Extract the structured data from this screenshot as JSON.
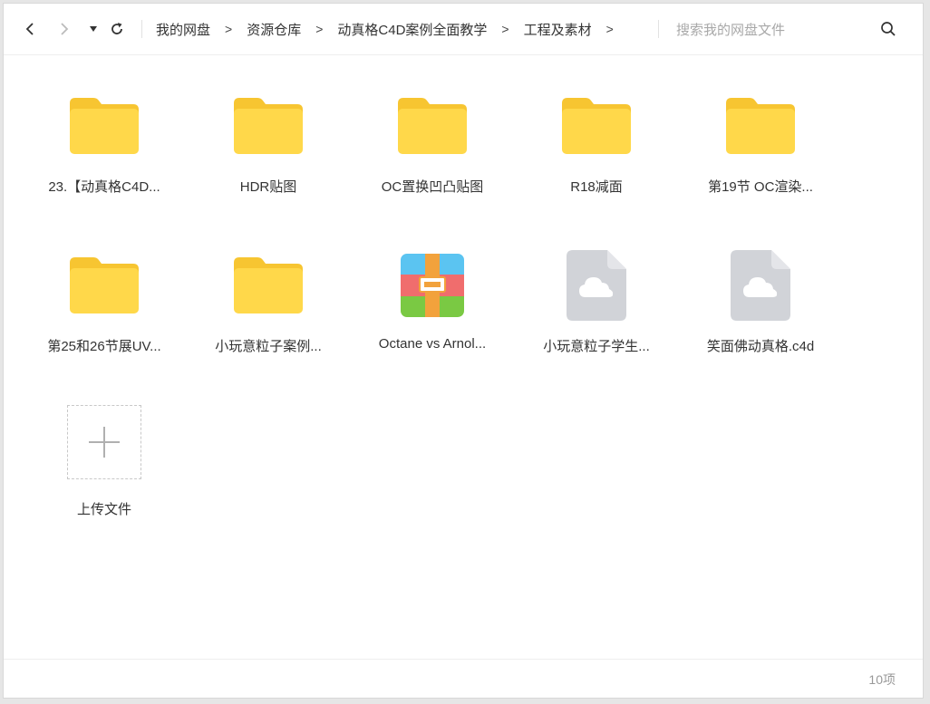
{
  "nav": {
    "back_icon": "chevron-left-icon",
    "forward_icon": "chevron-right-icon",
    "dropdown_icon": "caret-down-icon",
    "refresh_icon": "refresh-icon"
  },
  "breadcrumb": [
    {
      "label": "我的网盘"
    },
    {
      "label": "资源仓库"
    },
    {
      "label": "动真格C4D案例全面教学"
    },
    {
      "label": "工程及素材"
    }
  ],
  "breadcrumb_separator": ">",
  "search": {
    "placeholder": "搜索我的网盘文件",
    "value": ""
  },
  "items": [
    {
      "label": "23.【动真格C4D...",
      "icon": "folder-icon"
    },
    {
      "label": "HDR贴图",
      "icon": "folder-icon"
    },
    {
      "label": "OC置换凹凸贴图",
      "icon": "folder-icon"
    },
    {
      "label": "R18减面",
      "icon": "folder-icon"
    },
    {
      "label": "第19节 OC渲染...",
      "icon": "folder-icon"
    },
    {
      "label": "第25和26节展UV...",
      "icon": "folder-icon"
    },
    {
      "label": "小玩意粒子案例...",
      "icon": "folder-icon"
    },
    {
      "label": "Octane vs Arnol...",
      "icon": "archive-icon"
    },
    {
      "label": "小玩意粒子学生...",
      "icon": "cloud-file-icon"
    },
    {
      "label": "笑面佛动真格.c4d",
      "icon": "cloud-file-icon"
    }
  ],
  "upload": {
    "label": "上传文件",
    "icon": "plus-icon"
  },
  "status": {
    "count": "10项"
  },
  "colors": {
    "folder_back": "#f7c531",
    "folder_front": "#ffd84a",
    "cloud_file": "#d1d3d8",
    "archive_top": "#5bc4f1",
    "archive_mid": "#f06d6d",
    "archive_bottom": "#7ac943",
    "archive_band": "#f2a23c"
  }
}
